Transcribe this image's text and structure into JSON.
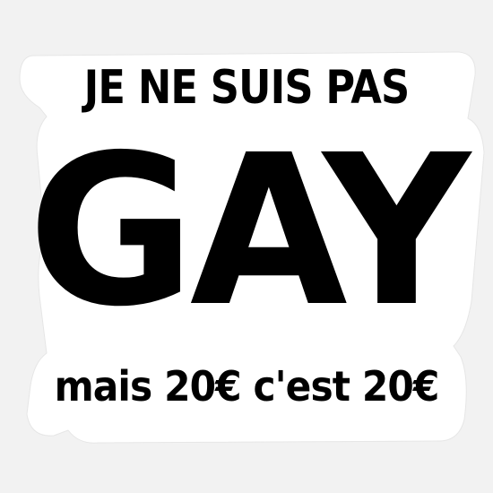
{
  "sticker": {
    "line_top": "JE NE SUIS PAS",
    "line_main": "GAY",
    "line_bottom": "mais 20€ c'est 20€",
    "text_color": "#000000",
    "sticker_color": "#ffffff",
    "background_color": "#f2f2f2"
  }
}
